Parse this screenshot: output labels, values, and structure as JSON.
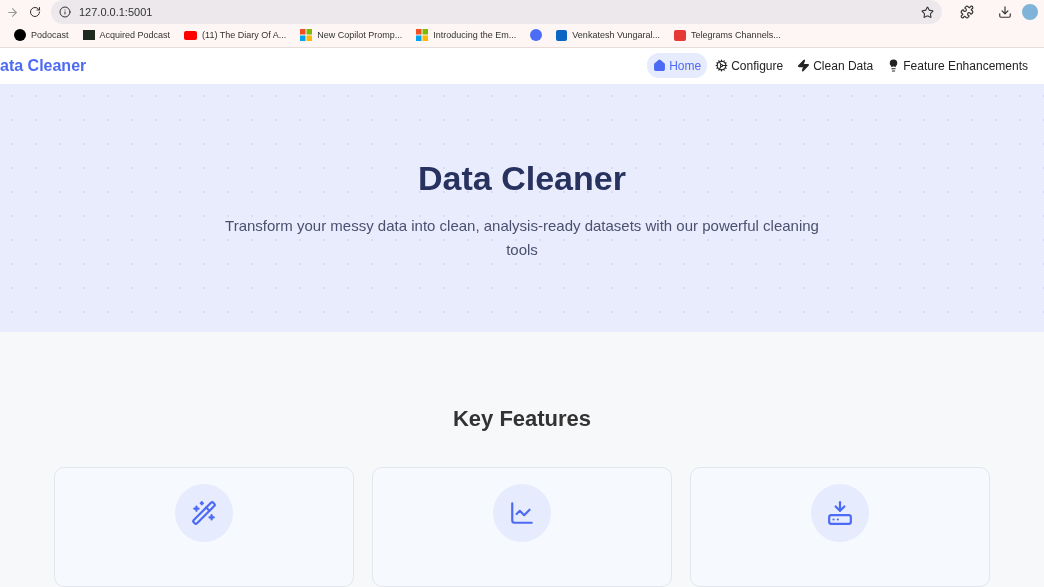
{
  "browser": {
    "url": "127.0.0.1:5001",
    "bookmarks": [
      {
        "label": "Podocast",
        "kind": "letter"
      },
      {
        "label": "Acquired Podcast",
        "kind": "dark"
      },
      {
        "label": "(11) The Diary Of A...",
        "kind": "video"
      },
      {
        "label": "New Copilot Promp...",
        "kind": "tiles"
      },
      {
        "label": "Introducing the Em...",
        "kind": "tiles"
      },
      {
        "kind": "circle"
      },
      {
        "label": "Venkatesh Vungaral...",
        "kind": "social"
      },
      {
        "label": "Telegrams Channels...",
        "kind": "red"
      }
    ]
  },
  "navbar": {
    "brand": "ata Cleaner",
    "items": [
      {
        "label": "Home",
        "kind": "home",
        "selected": true
      },
      {
        "label": "Configure",
        "kind": "gears",
        "selected": false
      },
      {
        "label": "Clean Data",
        "kind": "bolt",
        "selected": false
      },
      {
        "label": "Feature Enhancements",
        "kind": "bulb",
        "selected": false
      }
    ]
  },
  "hero": {
    "title": "Data Cleaner",
    "subtitle": "Transform your messy data into clean, analysis-ready datasets with our powerful cleaning tools"
  },
  "features": {
    "title": "Key Features",
    "cards": [
      {
        "kind": "wand"
      },
      {
        "kind": "chart"
      },
      {
        "kind": "download"
      }
    ]
  }
}
